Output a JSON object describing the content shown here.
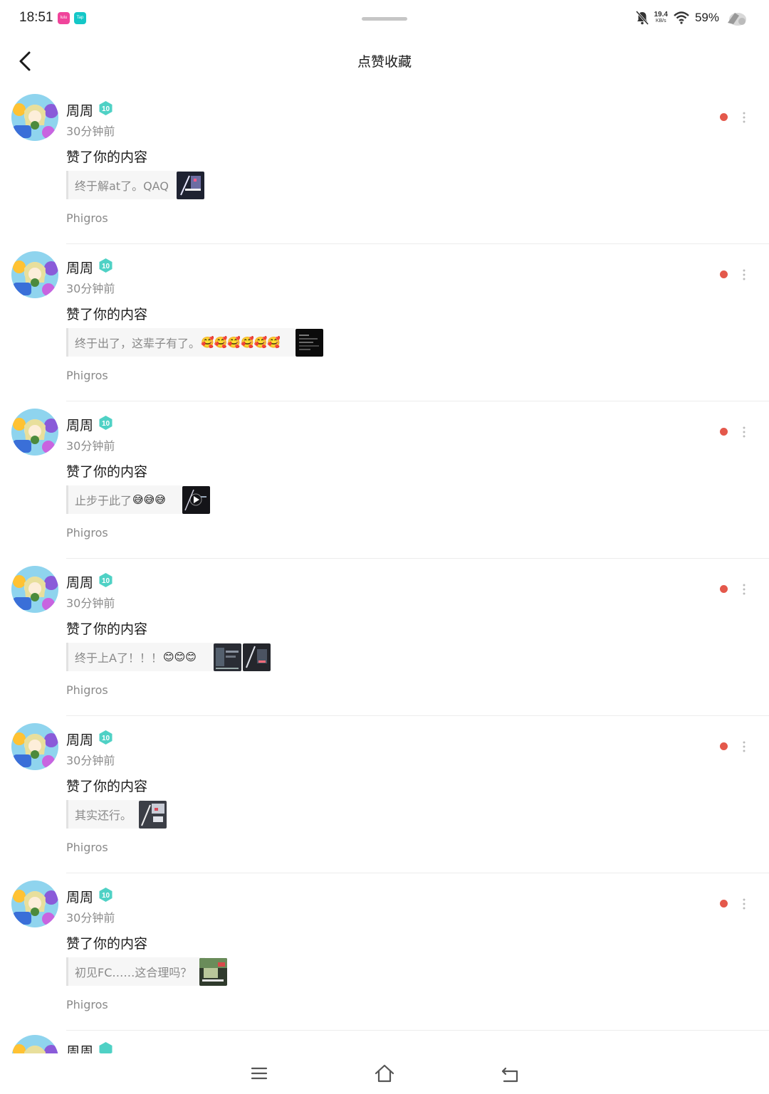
{
  "status_bar": {
    "time": "18:51",
    "app_badge_1": "lulu",
    "app_badge_2": "Tap",
    "net_speed_value": "19.4",
    "net_speed_unit": "KB/s",
    "battery": "59%",
    "icons": [
      "bell-off-icon",
      "wifi-icon",
      "phone-signal-icon"
    ]
  },
  "header": {
    "title": "点赞收藏",
    "back_icon": "chevron-left-icon"
  },
  "notifications": [
    {
      "username": "周周",
      "level": "10",
      "time": "30分钟前",
      "action": "赞了你的内容",
      "quote": "终于解at了。QAQ",
      "emoji": "",
      "thumbnails": 1,
      "tag": "Phigros"
    },
    {
      "username": "周周",
      "level": "10",
      "time": "30分钟前",
      "action": "赞了你的内容",
      "quote": "终于出了，这辈子有了。",
      "emoji": "🥰🥰🥰🥰🥰🥰",
      "thumbnails": 1,
      "tag": "Phigros"
    },
    {
      "username": "周周",
      "level": "10",
      "time": "30分钟前",
      "action": "赞了你的内容",
      "quote": "止步于此了",
      "emoji": "😅😅😅",
      "thumbnails": 1,
      "tag": "Phigros"
    },
    {
      "username": "周周",
      "level": "10",
      "time": "30分钟前",
      "action": "赞了你的内容",
      "quote": "终于上A了！！！",
      "emoji": "😊😊😊",
      "thumbnails": 2,
      "tag": "Phigros"
    },
    {
      "username": "周周",
      "level": "10",
      "time": "30分钟前",
      "action": "赞了你的内容",
      "quote": "其实还行。",
      "emoji": "",
      "thumbnails": 1,
      "tag": "Phigros"
    },
    {
      "username": "周周",
      "level": "10",
      "time": "30分钟前",
      "action": "赞了你的内容",
      "quote": "初见FC……这合理吗？",
      "emoji": "",
      "thumbnails": 1,
      "tag": "Phigros"
    }
  ],
  "partial_item": {
    "username": "周周"
  },
  "colors": {
    "unread_dot": "#e4584b",
    "level_badge": "#4fd1c5",
    "muted_text": "#8c8c8c"
  },
  "nav_bar": {
    "icons": [
      "menu-icon",
      "home-icon",
      "back-icon"
    ]
  }
}
